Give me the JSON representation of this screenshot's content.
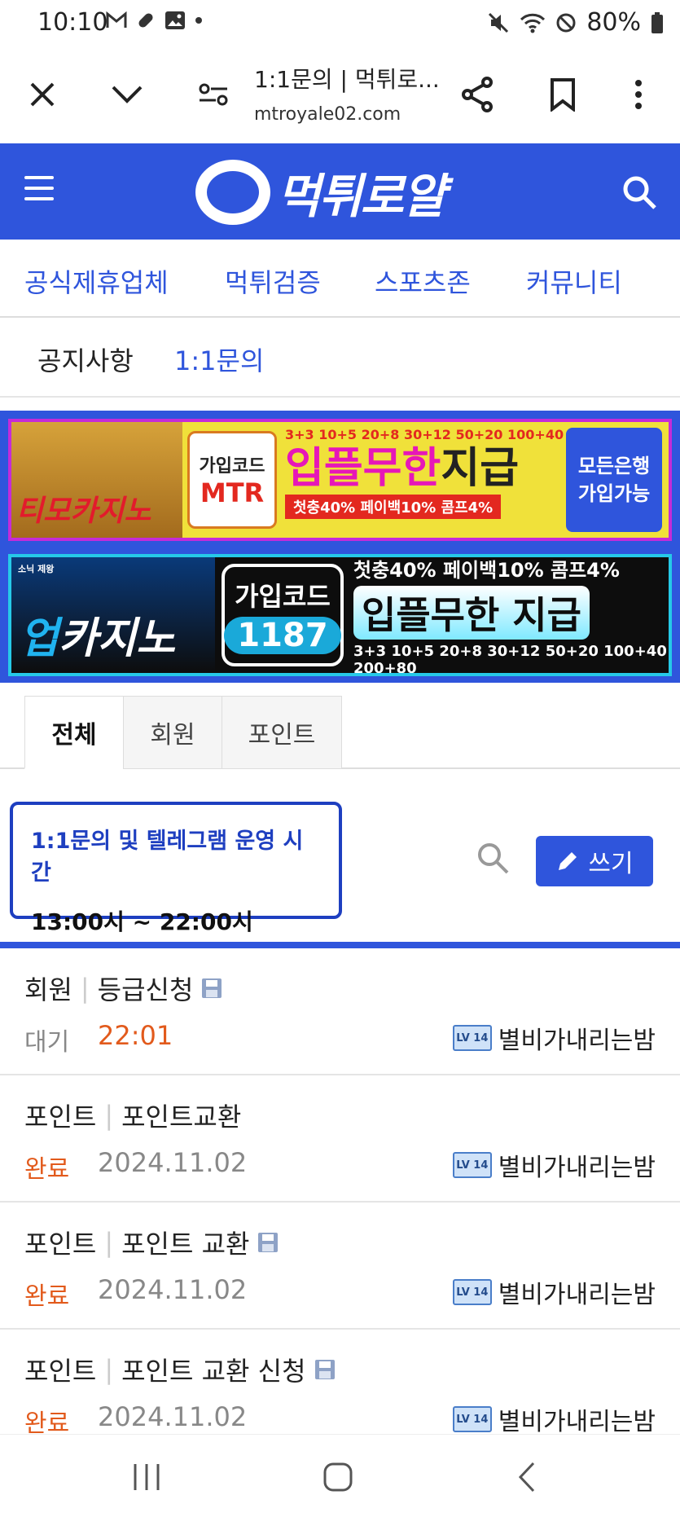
{
  "status_bar": {
    "time": "10:10",
    "battery": "80%",
    "left_icons": [
      "gmail-icon",
      "pill-icon",
      "gallery-icon",
      "dot-icon"
    ],
    "right_icons": [
      "mute-icon",
      "wifi-icon",
      "block-icon",
      "battery-icon"
    ]
  },
  "browser": {
    "title": "1:1문의 | 먹튀로...",
    "domain": "mtroyale02.com"
  },
  "site": {
    "logo_text": "먹튀로얄",
    "brand_color": "#2f55dc"
  },
  "nav": {
    "items": [
      "공식제휴업체",
      "먹튀검증",
      "스포츠존",
      "커뮤니티"
    ]
  },
  "sub_nav": {
    "items": [
      "공지사항",
      "1:1문의"
    ],
    "active": "1:1문의"
  },
  "banner1": {
    "brand": "티모카지노",
    "code_label": "가입코드",
    "code": "MTR",
    "top_line": "3+3 10+5 20+8 30+12 50+20 100+40",
    "main_a": "입플무한",
    "main_b": "지급",
    "bottom_line": "첫충40% 페이백10% 콤프4%",
    "right_line1": "모든은행",
    "right_line2": "가입가능"
  },
  "banner2": {
    "badge": "소닉 제왕",
    "brand_up": "업",
    "brand_rest": "카지노",
    "code_label": "가입코드",
    "code": "1187",
    "top_line": "첫충40% 페이백10% 콤프4%",
    "main": "입플무한 지급",
    "bottom_line": "3+3 10+5 20+8 30+12 50+20 100+40 200+80"
  },
  "tabs": {
    "items": [
      "전체",
      "회원",
      "포인트"
    ],
    "active": "전체"
  },
  "notice": {
    "title": "1:1문의 및 텔레그램 운영 시간",
    "time": "13:00시 ~ 22:00시"
  },
  "write_button": "쓰기",
  "posts": [
    {
      "category": "회원",
      "title": "등급신청",
      "has_icon": true,
      "status": "대기",
      "date": "22:01",
      "author": "별비가내리는밤",
      "level": "LV 14"
    },
    {
      "category": "포인트",
      "title": "포인트교환",
      "has_icon": false,
      "status": "완료",
      "date": "2024.11.02",
      "author": "별비가내리는밤",
      "level": "LV 14"
    },
    {
      "category": "포인트",
      "title": "포인트 교환",
      "has_icon": true,
      "status": "완료",
      "date": "2024.11.02",
      "author": "별비가내리는밤",
      "level": "LV 14"
    },
    {
      "category": "포인트",
      "title": "포인트 교환 신청",
      "has_icon": true,
      "status": "완료",
      "date": "2024.11.02",
      "author": "별비가내리는밤",
      "level": "LV 14"
    }
  ],
  "android_nav": [
    "recents-icon",
    "home-icon",
    "back-icon"
  ]
}
